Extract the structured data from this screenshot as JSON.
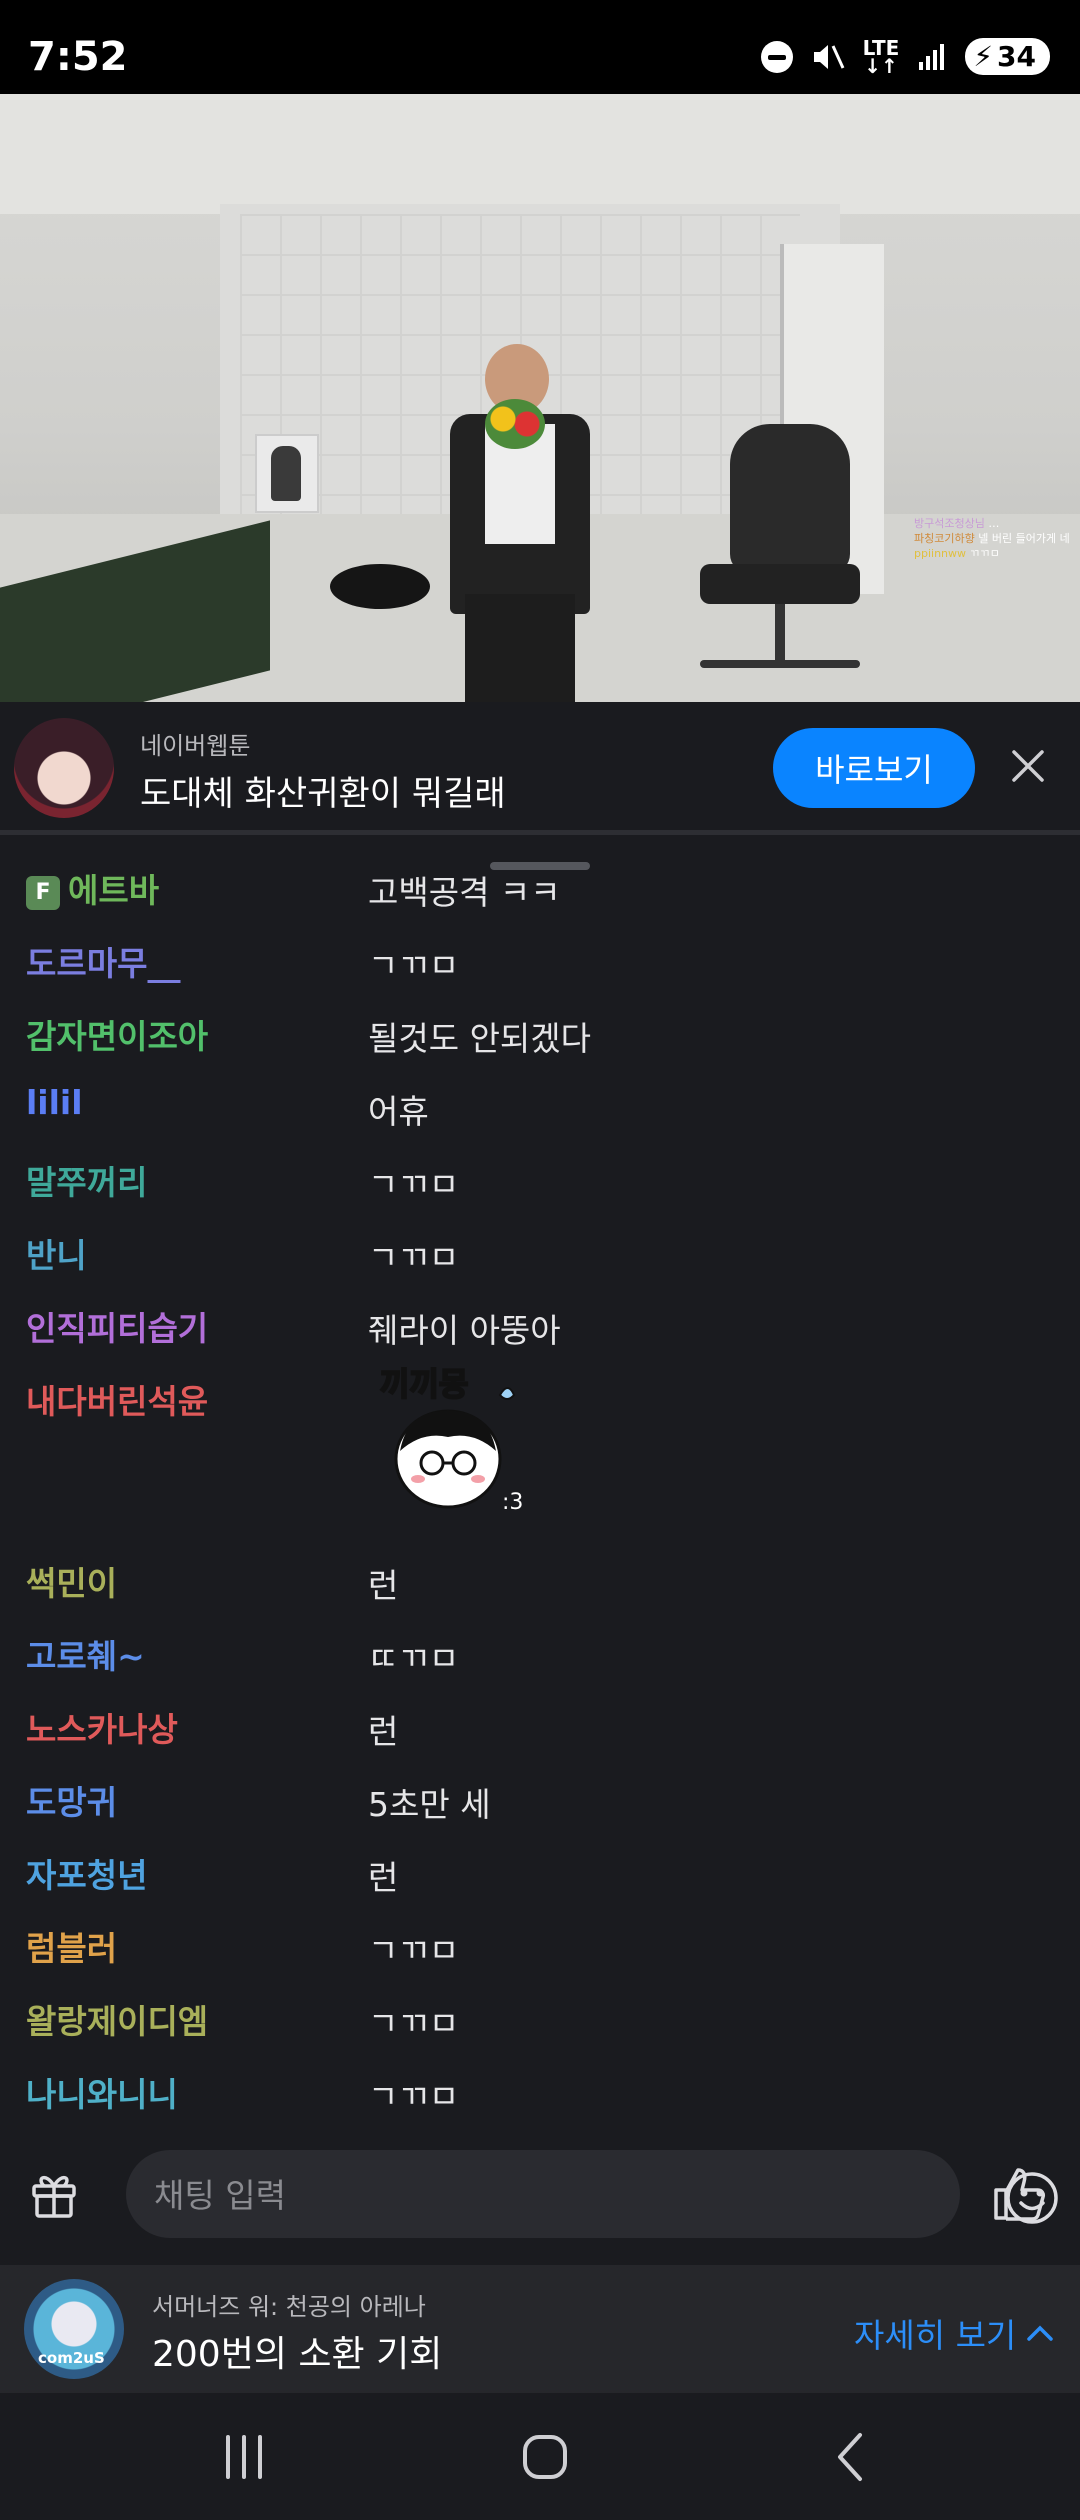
{
  "status_bar": {
    "time": "7:52",
    "network": "LTE",
    "battery": "34"
  },
  "video": {
    "overlay_chat": [
      {
        "user": "방구석조청상님",
        "text": "…"
      },
      {
        "user": "파칭코기하향",
        "text": "넬 버린 들어가게 네"
      },
      {
        "user": "ppiinnww",
        "text": "ㄲㄲㅁ"
      }
    ]
  },
  "banner": {
    "subtitle": "네이버웹툰",
    "title": "도대체 화산귀환이 뭐길래",
    "action_label": "바로보기",
    "close_icon": "close-icon"
  },
  "chat": {
    "messages": [
      {
        "name": "에트바",
        "message": "고백공격 ㅋㅋ",
        "color": "#6fb85b",
        "badge": "F"
      },
      {
        "name": "도르마무__",
        "message": "ㄱㄲㅁ",
        "color": "#7b7ee0"
      },
      {
        "name": "감자면이조아",
        "message": "될것도 안되겠다",
        "color": "#52c06b"
      },
      {
        "name": "lilil",
        "message": "어휴",
        "color": "#5b7ef5"
      },
      {
        "name": "말쭈꺼리",
        "message": "ㄱㄲㅁ",
        "color": "#3fa99a"
      },
      {
        "name": "반니",
        "message": "ㄱㄲㅁ",
        "color": "#4fa3c8"
      },
      {
        "name": "인직피티습기",
        "message": "줴라이 아뚱아",
        "color": "#b26fd9"
      },
      {
        "name": "내다버린석윤",
        "message": "",
        "color": "#e05a5a",
        "sticker": "끼끼몽"
      },
      {
        "name": "썩민이",
        "message": "런",
        "color": "#a9b05a"
      },
      {
        "name": "고로췌~",
        "message": "ㄸㄲㅁ",
        "color": "#5c8de8"
      },
      {
        "name": "노스카나상",
        "message": "런",
        "color": "#e05a5a"
      },
      {
        "name": "도망귀",
        "message": "5초만 세",
        "color": "#5c8de8"
      },
      {
        "name": "자포청년",
        "message": "런",
        "color": "#4fa3e0"
      },
      {
        "name": "럼블러",
        "message": "ㄱㄲㅁ",
        "color": "#e0a24a"
      },
      {
        "name": "왈랑제이디엠",
        "message": "ㄱㄲㅁ",
        "color": "#a9b05a"
      },
      {
        "name": "나니와니니",
        "message": "ㄱㄲㅁ",
        "color": "#4fb0c8"
      }
    ]
  },
  "input_bar": {
    "placeholder": "채팅 입력"
  },
  "ad": {
    "subtitle": "서머너즈 워: 천공의 아레나",
    "title": "200번의 소환 기회",
    "more_label": "자세히 보기",
    "logo_text": "com2uS"
  }
}
